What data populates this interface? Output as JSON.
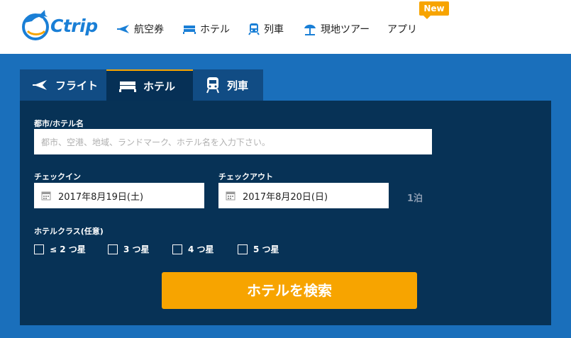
{
  "header": {
    "logo_text": "Ctrip",
    "nav": [
      {
        "label": "航空券",
        "icon": "plane-icon"
      },
      {
        "label": "ホテル",
        "icon": "bed-icon"
      },
      {
        "label": "列車",
        "icon": "train-icon"
      },
      {
        "label": "現地ツアー",
        "icon": "beach-umbrella-icon"
      },
      {
        "label": "アプリ",
        "icon": ""
      }
    ],
    "new_badge": "New"
  },
  "tabs": [
    {
      "label": "フライト",
      "icon": "plane-icon",
      "active": false
    },
    {
      "label": "ホテル",
      "icon": "bed-icon",
      "active": true
    },
    {
      "label": "列車",
      "icon": "train-icon",
      "active": false
    }
  ],
  "form": {
    "destination_label": "都市/ホテル名",
    "destination_placeholder": "都市、空港、地域、ランドマーク、ホテル名を入力下さい。",
    "checkin_label": "チェックイン",
    "checkin_value": "2017年8月19日(土)",
    "checkout_label": "チェックアウト",
    "checkout_value": "2017年8月20日(日)",
    "nights": "1泊",
    "class_label": "ホテルクラス(任意)",
    "classes": [
      "≤ 2 つ星",
      "3 つ星",
      "4 つ星",
      "5 つ星"
    ],
    "search_button": "ホテルを検索"
  },
  "colors": {
    "brand_blue": "#1a6fbb",
    "panel_navy": "#073256",
    "accent_orange": "#f7a400"
  }
}
